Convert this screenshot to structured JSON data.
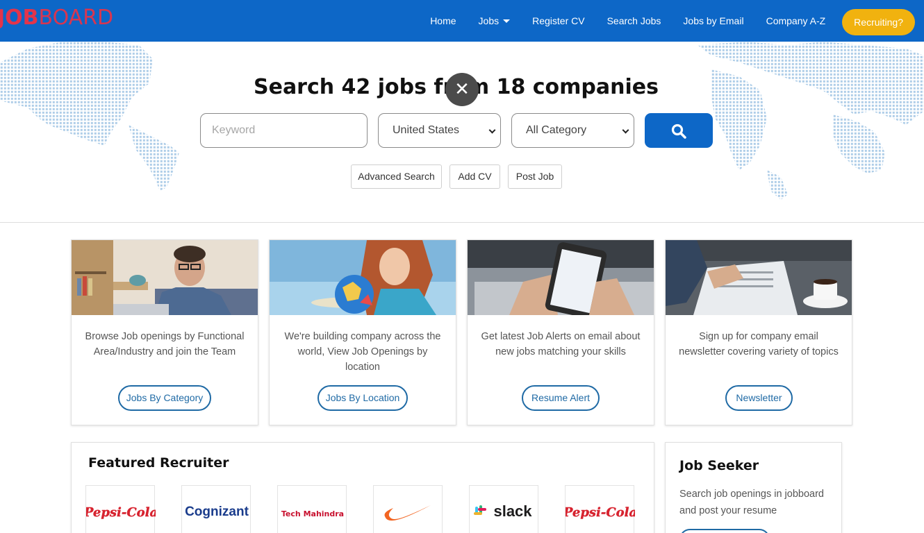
{
  "nav": {
    "logo_job": "JOB",
    "logo_board": "BOARD",
    "links": [
      "Home",
      "Jobs",
      "Register CV",
      "Search Jobs",
      "Jobs by Email",
      "Company A-Z"
    ],
    "cta": "Recruiting?",
    "brand_color": "#0d67c7",
    "cta_color": "#f1b20f"
  },
  "hero": {
    "close_glyph": "✕",
    "title": "Search 42 jobs from 18 companies",
    "keyword_placeholder": "Keyword",
    "country_value": "United States",
    "category_value": "All Category",
    "pills": [
      "Advanced Search",
      "Add CV",
      "Post Job"
    ]
  },
  "cards": [
    {
      "desc": "Browse Job openings by Functional Area/Industry and join the Team",
      "button": "Jobs By Category"
    },
    {
      "desc": "We're building company across the world, View Job Openings by location",
      "button": "Jobs By Location"
    },
    {
      "desc": "Get latest Job Alerts on email about new jobs matching your skills",
      "button": "Resume Alert"
    },
    {
      "desc": "Sign up for company email newsletter covering variety of topics",
      "button": "Newsletter"
    }
  ],
  "featured": {
    "title": "Featured Recruiter",
    "logos": [
      "Pepsi-Cola",
      "Cognizant",
      "Tech Mahindra",
      "Nike",
      "slack",
      "Pepsi-Cola"
    ]
  },
  "seeker": {
    "title": "Job Seeker",
    "text": "Search job openings in jobboard and post your resume"
  }
}
